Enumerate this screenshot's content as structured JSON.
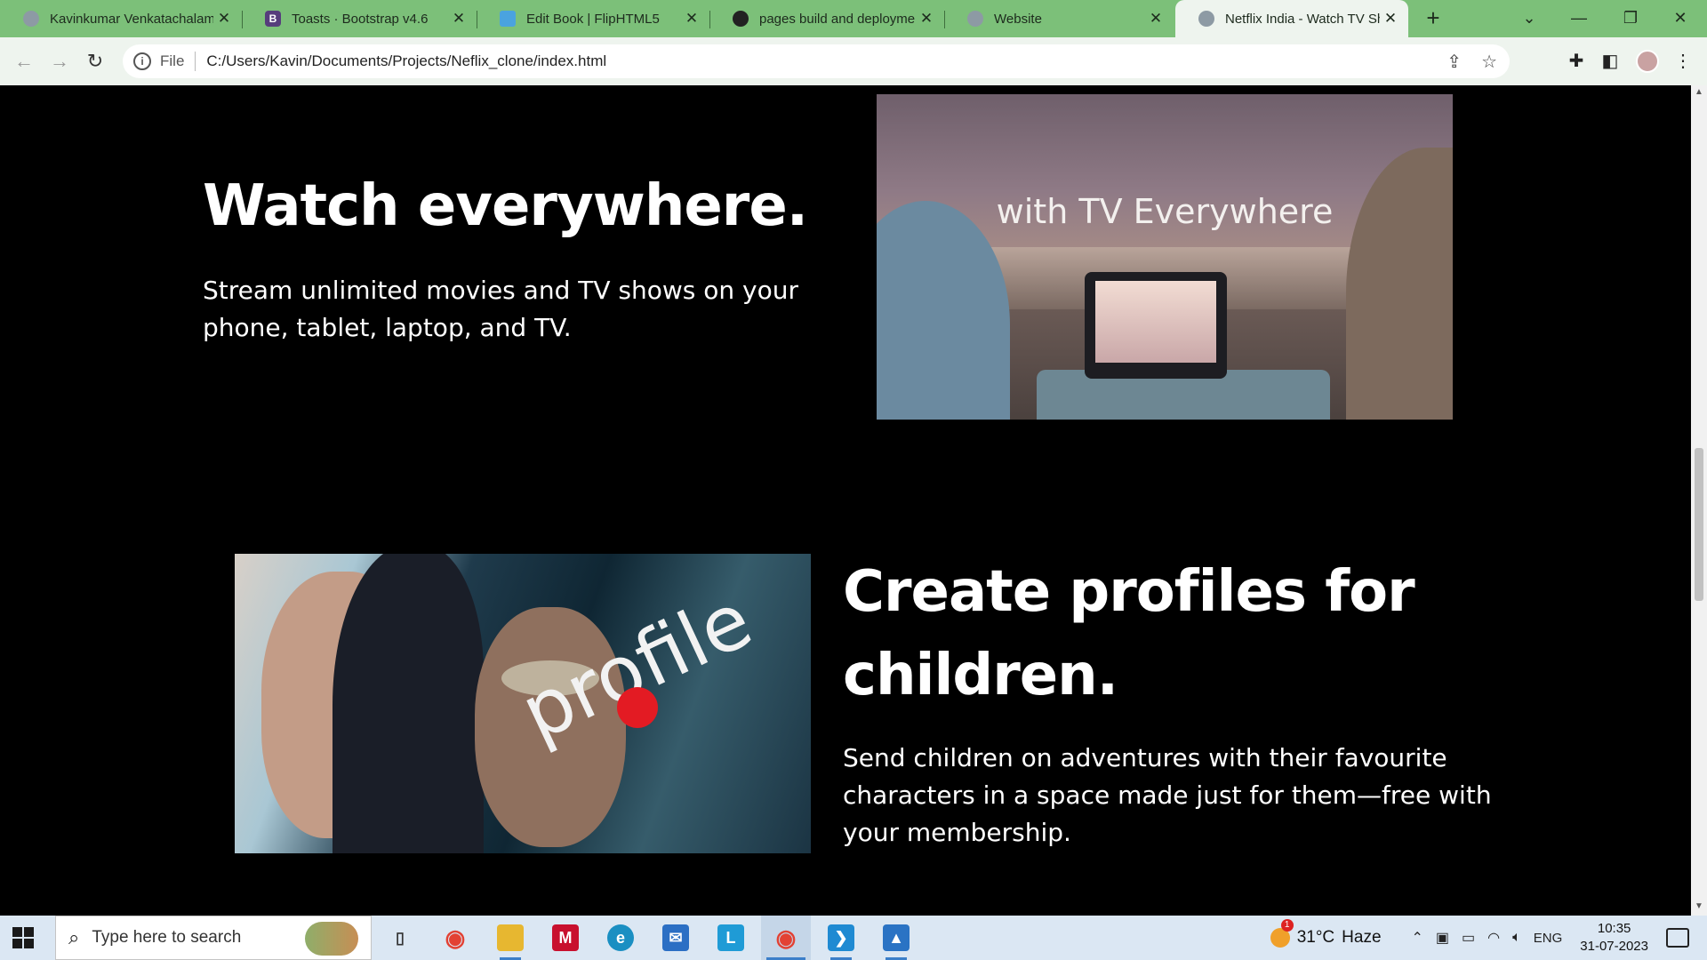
{
  "browser": {
    "tabs": [
      {
        "title": "Kavinkumar Venkatachalam",
        "favicon": "globe-icon",
        "color": "#8d9aa4"
      },
      {
        "title": "Toasts · Bootstrap v4.6",
        "favicon": "bootstrap-icon",
        "color": "#563d7c"
      },
      {
        "title": "Edit Book | FlipHTML5",
        "favicon": "fliphtml5-icon",
        "color": "#4aa3df"
      },
      {
        "title": "pages build and deploymen",
        "favicon": "github-icon",
        "color": "#222222"
      },
      {
        "title": "Website",
        "favicon": "globe-icon",
        "color": "#8d9aa4"
      },
      {
        "title": "Netflix India - Watch TV Sh",
        "favicon": "globe-icon",
        "color": "#8d9aa4"
      }
    ],
    "new_tab_glyph": "+",
    "address": {
      "scheme": "File",
      "url": "C:/Users/Kavin/Documents/Projects/Neflix_clone/index.html"
    }
  },
  "page": {
    "section_tv": {
      "title": "Watch everywhere.",
      "description": "Stream unlimited movies and TV shows on your phone, tablet, laptop, and TV.",
      "image_caption": "with TV Everywhere"
    },
    "section_kids": {
      "title_line1": "Create profiles for",
      "title_line2": "children.",
      "description": "Send children on adventures with their favourite characters in a space made just for them—free with your membership.",
      "image_wordmark": "profile"
    }
  },
  "taskbar": {
    "search_placeholder": "Type here to search",
    "apps": [
      {
        "name": "task-view-icon",
        "glyph": "▯",
        "color": "#333333"
      },
      {
        "name": "chrome-icon",
        "glyph": "◉",
        "color": "#e34133"
      },
      {
        "name": "file-explorer-icon",
        "glyph": "▬",
        "color": "#e7b730"
      },
      {
        "name": "mcafee-icon",
        "glyph": "M",
        "color": "#c8102e"
      },
      {
        "name": "edge-icon",
        "glyph": "e",
        "color": "#1a8fc2"
      },
      {
        "name": "mail-icon",
        "glyph": "✉",
        "color": "#2b6fc4"
      },
      {
        "name": "l-app-icon",
        "glyph": "L",
        "color": "#1f9bd6"
      },
      {
        "name": "chrome-icon",
        "glyph": "◉",
        "color": "#e34133"
      },
      {
        "name": "vscode-icon",
        "glyph": "❯",
        "color": "#1f8ad2"
      },
      {
        "name": "photos-icon",
        "glyph": "▲",
        "color": "#2a73c4"
      }
    ],
    "weather": {
      "temp": "31°C",
      "condition": "Haze"
    },
    "language": "ENG",
    "time": "10:35",
    "date": "31-07-2023"
  }
}
